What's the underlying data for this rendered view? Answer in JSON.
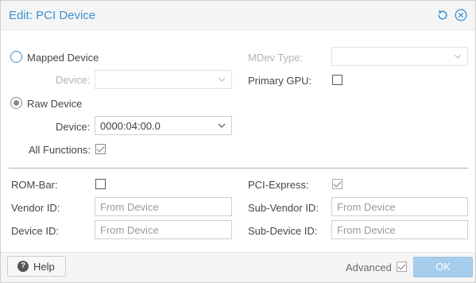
{
  "dialog": {
    "title": "Edit: PCI Device"
  },
  "mapped": {
    "label": "Mapped Device",
    "device_label": "Device:",
    "device_value": ""
  },
  "raw": {
    "label": "Raw Device",
    "device_label": "Device:",
    "device_value": "0000:04:00.0",
    "all_functions_label": "All Functions:",
    "all_functions_checked": true
  },
  "mdev": {
    "label": "MDev Type:",
    "value": ""
  },
  "primary_gpu": {
    "label": "Primary GPU:",
    "checked": false
  },
  "advanced": {
    "rom_bar_label": "ROM-Bar:",
    "rom_bar_checked": false,
    "pcie_label": "PCI-Express:",
    "pcie_checked": true,
    "vendor_id_label": "Vendor ID:",
    "vendor_id_placeholder": "From Device",
    "device_id_label": "Device ID:",
    "device_id_placeholder": "From Device",
    "sub_vendor_id_label": "Sub-Vendor ID:",
    "sub_vendor_id_placeholder": "From Device",
    "sub_device_id_label": "Sub-Device ID:",
    "sub_device_id_placeholder": "From Device"
  },
  "footer": {
    "help_label": "Help",
    "advanced_label": "Advanced",
    "advanced_checked": true,
    "ok_label": "OK"
  },
  "colors": {
    "accent": "#3892d4",
    "ok_disabled": "#a6cdec"
  }
}
